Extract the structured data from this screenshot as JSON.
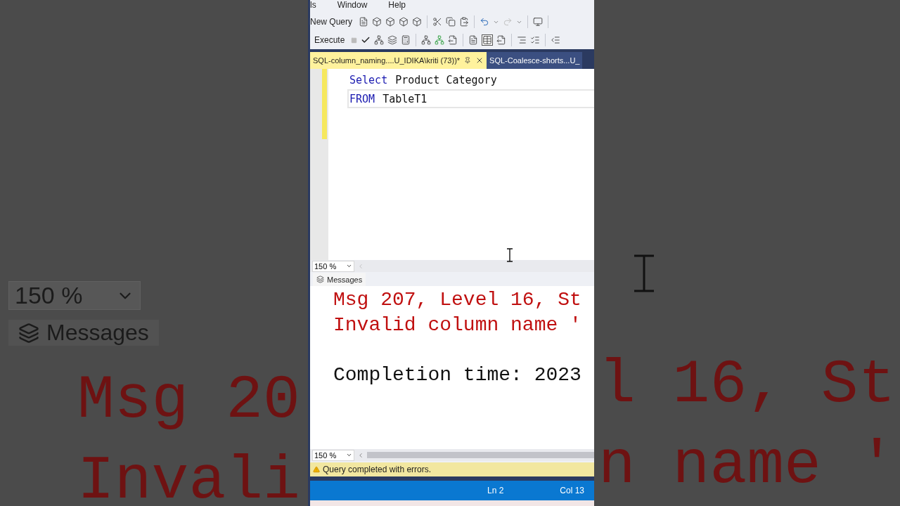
{
  "backdrop_left": {
    "zoom": "150 %",
    "results_tab": "Messages",
    "lines": [
      "Msg 20",
      "Invali"
    ]
  },
  "backdrop_right": {
    "lines": [
      "l 16, St",
      "n name '"
    ]
  },
  "menu": [
    "ls",
    "Window",
    "Help"
  ],
  "toolbar": {
    "new_query": "New Query",
    "execute": "Execute"
  },
  "tabs": [
    {
      "label": "SQL-column_naming....U_IDIKA\\kriti (73))*",
      "selected": true
    },
    {
      "label": "SQL-Coalesce-shorts...U_",
      "selected": false
    }
  ],
  "editor": {
    "lines": [
      {
        "current": false,
        "tokens": [
          {
            "kind": "keyword",
            "text": "Select"
          },
          {
            "kind": "ident",
            "text": "Product Category"
          }
        ]
      },
      {
        "current": true,
        "tokens": [
          {
            "kind": "keyword",
            "text": "FROM"
          },
          {
            "kind": "ident",
            "text": "TableT1"
          }
        ]
      }
    ],
    "zoom": "150 %"
  },
  "results": {
    "tab": "Messages",
    "messages": [
      {
        "kind": "error",
        "text": "Msg 207, Level 16, St"
      },
      {
        "kind": "error",
        "text": "Invalid column name '"
      },
      {
        "kind": "info",
        "text": "Completion time: 2023"
      }
    ],
    "zoom": "150 %"
  },
  "query_status": {
    "kind": "warning",
    "text": "Query completed with errors."
  },
  "status_bar": {
    "line": "Ln 2",
    "column": "Col 13"
  }
}
